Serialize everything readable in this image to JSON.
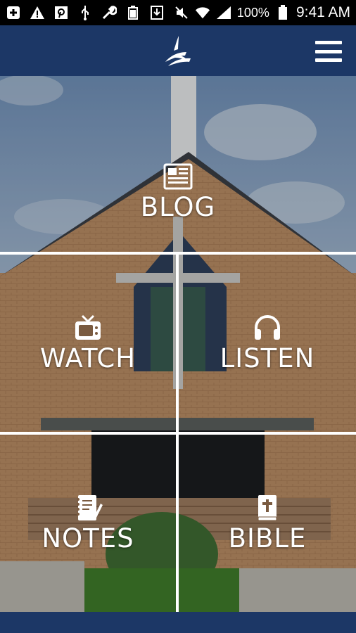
{
  "status_bar": {
    "icons": [
      "add-box-icon",
      "warning-icon",
      "pinterest-icon",
      "usb-icon",
      "wrench-icon",
      "battery-full-icon",
      "download-icon",
      "mute-icon",
      "wifi-icon",
      "signal-icon"
    ],
    "battery": "100%",
    "time": "9:41 AM"
  },
  "header": {
    "logo": "church-logo-icon",
    "menu": "hamburger-menu-icon",
    "colors": {
      "header_bg": "#1c3766"
    }
  },
  "tiles": {
    "blog": {
      "label": "BLOG",
      "icon": "newspaper-icon"
    },
    "watch": {
      "label": "WATCH",
      "icon": "tv-icon"
    },
    "listen": {
      "label": "LISTEN",
      "icon": "headphones-icon"
    },
    "notes": {
      "label": "NOTES",
      "icon": "notebook-icon"
    },
    "bible": {
      "label": "BIBLE",
      "icon": "bible-icon"
    }
  }
}
